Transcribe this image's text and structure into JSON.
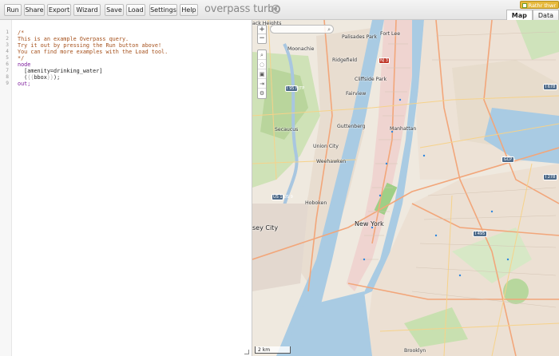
{
  "toolbar": {
    "buttons": [
      "Run",
      "Share",
      "Export",
      "Wizard",
      "Save",
      "Load",
      "Settings",
      "Help"
    ],
    "app_title": "overpass turbo"
  },
  "editor": {
    "line_numbers": [
      "1",
      "2",
      "3",
      "4",
      "5",
      "6",
      "7",
      "8",
      "9"
    ],
    "lines": [
      {
        "text": "/*",
        "kind": "comment"
      },
      {
        "text": "This is an example Overpass query.",
        "kind": "comment"
      },
      {
        "text": "Try it out by pressing the Run button above!",
        "kind": "comment"
      },
      {
        "text": "You can find more examples with the Load tool.",
        "kind": "comment"
      },
      {
        "text": "*/",
        "kind": "comment"
      },
      {
        "text": "node",
        "kind": "kw"
      },
      {
        "text": "  [amenity=drinking_water]",
        "kind": "plain"
      },
      {
        "text": "  ({{bbox}});",
        "kind": "bbox"
      },
      {
        "text": "out;",
        "kind": "kw"
      }
    ]
  },
  "map": {
    "tabs": [
      "Map",
      "Data"
    ],
    "active_tab": "Map",
    "warning_badge": "Rathr thwr",
    "zoom_in": "+",
    "zoom_out": "−",
    "tools": [
      "search-icon",
      "locate-icon",
      "image-icon",
      "fullscreen-icon",
      "settings-icon"
    ],
    "search_placeholder": "",
    "scale_label": "2 km",
    "places": [
      {
        "name": "ack Heights",
        "cls": ""
      },
      {
        "name": "Palisades Park",
        "cls": ""
      },
      {
        "name": "Fort Lee",
        "cls": ""
      },
      {
        "name": "Moonachie",
        "cls": ""
      },
      {
        "name": "Ridgefield",
        "cls": ""
      },
      {
        "name": "Cliffside Park",
        "cls": ""
      },
      {
        "name": "Fairview",
        "cls": ""
      },
      {
        "name": "Secaucus",
        "cls": ""
      },
      {
        "name": "Guttenberg",
        "cls": ""
      },
      {
        "name": "Manhattan",
        "cls": ""
      },
      {
        "name": "Union City",
        "cls": ""
      },
      {
        "name": "Weehawken",
        "cls": ""
      },
      {
        "name": "Hoboken",
        "cls": ""
      },
      {
        "name": "New York",
        "cls": "big"
      },
      {
        "name": "sey City",
        "cls": "big"
      },
      {
        "name": "Brooklyn",
        "cls": ""
      }
    ],
    "shields": [
      {
        "text": "I 95 NJTP",
        "cls": ""
      },
      {
        "text": "US 1 US 9",
        "cls": ""
      },
      {
        "text": "I 678",
        "cls": ""
      },
      {
        "text": "GCP",
        "cls": ""
      },
      {
        "text": "I 278",
        "cls": ""
      },
      {
        "text": "I 495",
        "cls": ""
      },
      {
        "text": "NJ 3",
        "cls": "red"
      }
    ]
  }
}
